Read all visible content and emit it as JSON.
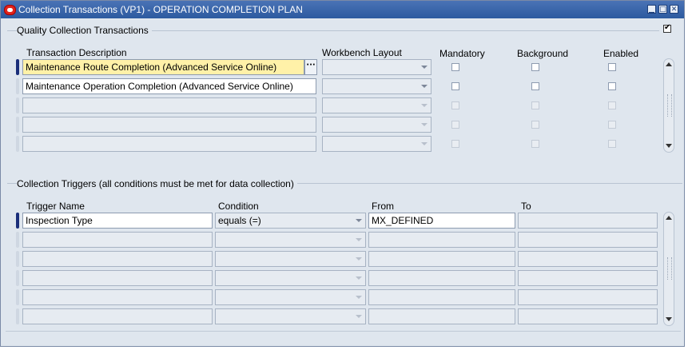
{
  "window": {
    "title": "Collection Transactions (VP1) - OPERATION COMPLETION PLAN",
    "controls": [
      "minimize-icon",
      "maximize-icon",
      "close-icon"
    ]
  },
  "transactions": {
    "section_title": "Quality Collection Transactions",
    "checked_top_right": true,
    "headers": {
      "description": "Transaction Description",
      "layout": "Workbench Layout",
      "mandatory": "Mandatory",
      "background": "Background",
      "enabled": "Enabled"
    },
    "rows": [
      {
        "description": "Maintenance Route Completion (Advanced Service Online)",
        "layout": "",
        "mandatory": false,
        "background": false,
        "enabled": false
      },
      {
        "description": "Maintenance Operation Completion (Advanced Service Online)",
        "layout": "",
        "mandatory": false,
        "background": false,
        "enabled": false
      },
      {
        "description": "",
        "layout": "",
        "mandatory": false,
        "background": false,
        "enabled": false
      },
      {
        "description": "",
        "layout": "",
        "mandatory": false,
        "background": false,
        "enabled": false
      },
      {
        "description": "",
        "layout": "",
        "mandatory": false,
        "background": false,
        "enabled": false
      }
    ]
  },
  "triggers": {
    "section_title": "Collection Triggers (all conditions must be met for data collection)",
    "headers": {
      "name": "Trigger Name",
      "condition": "Condition",
      "from": "From",
      "to": "To"
    },
    "rows": [
      {
        "name": "Inspection Type",
        "condition": "equals (=)",
        "from": "MX_DEFINED",
        "to": ""
      },
      {
        "name": "",
        "condition": "",
        "from": "",
        "to": ""
      },
      {
        "name": "",
        "condition": "",
        "from": "",
        "to": ""
      },
      {
        "name": "",
        "condition": "",
        "from": "",
        "to": ""
      },
      {
        "name": "",
        "condition": "",
        "from": "",
        "to": ""
      },
      {
        "name": "",
        "condition": "",
        "from": "",
        "to": ""
      }
    ]
  },
  "colors": {
    "title_bar": "#2c5aa0",
    "window_bg": "#dfe6ee",
    "current_field": "#fff1a8",
    "active_row_indicator": "#1a2e7a"
  }
}
